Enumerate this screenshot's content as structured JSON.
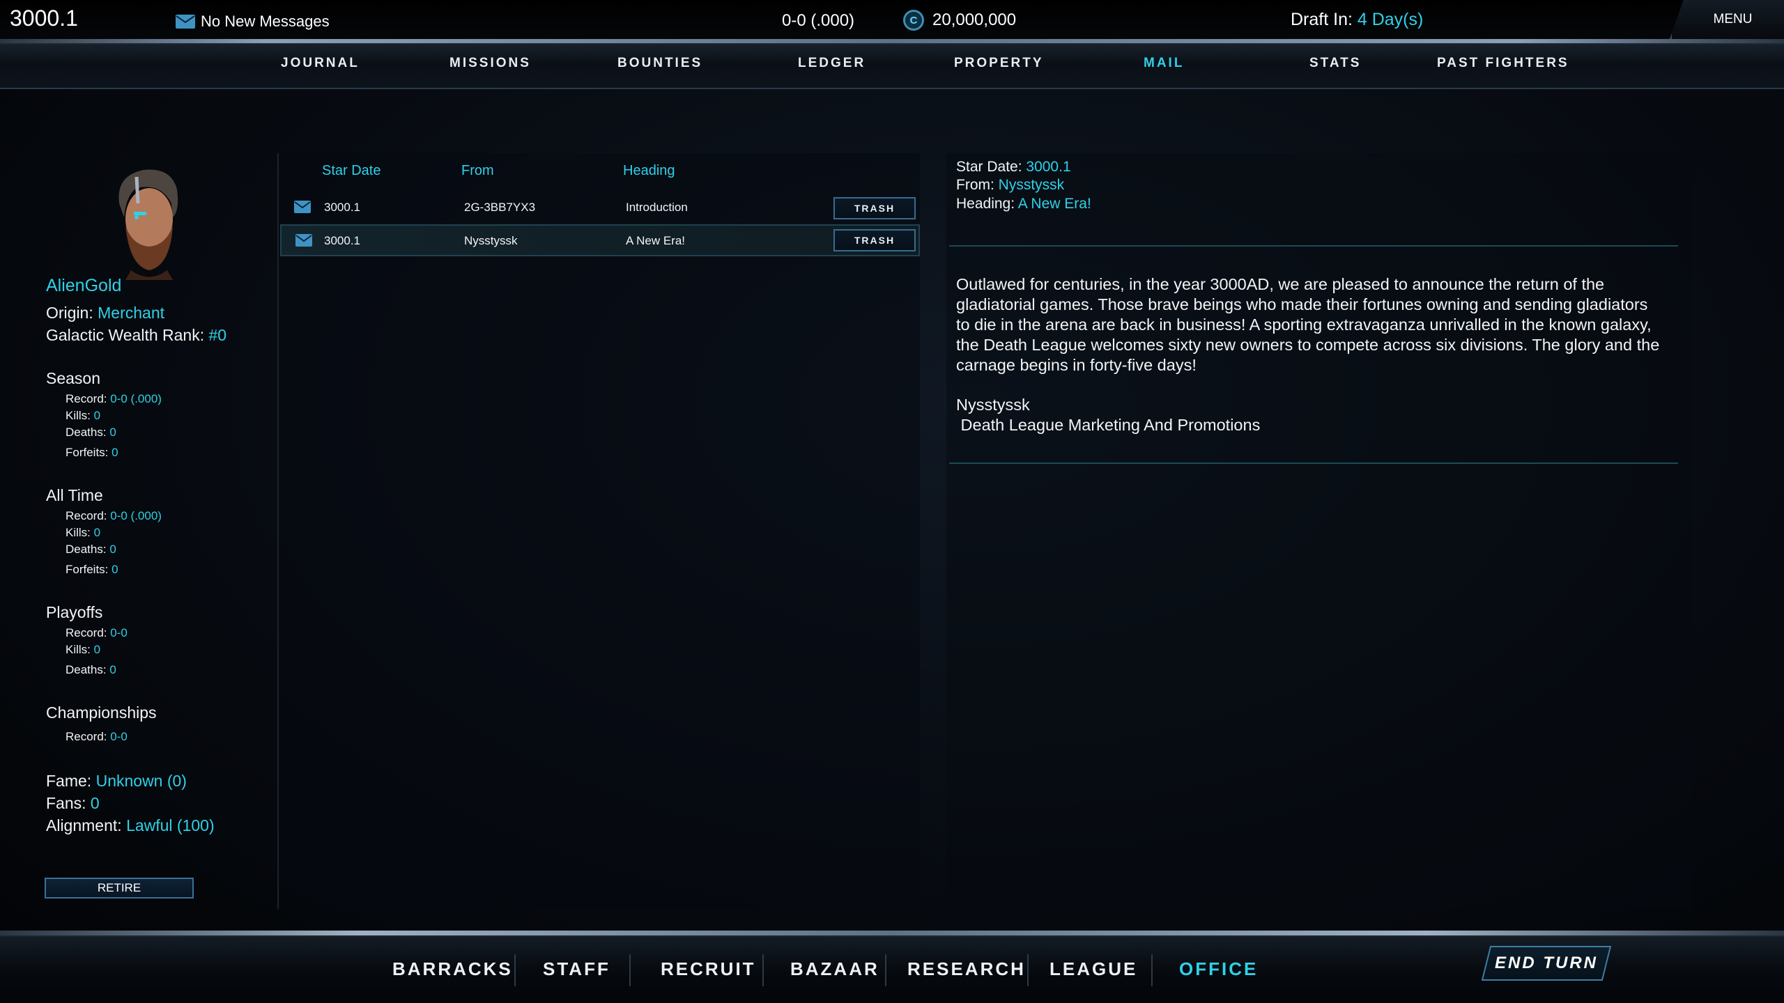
{
  "top": {
    "stardate": "3000.1",
    "messages": "No New Messages",
    "record": "0-0 (.000)",
    "credits": "20,000,000",
    "draft_label": "Draft In: ",
    "draft_value": "4 Day(s)",
    "menu": "MENU"
  },
  "nav": {
    "tabs": [
      "JOURNAL",
      "MISSIONS",
      "BOUNTIES",
      "LEDGER",
      "PROPERTY",
      "MAIL",
      "STATS",
      "PAST FIGHTERS"
    ],
    "active": "MAIL"
  },
  "profile": {
    "name": "AlienGold",
    "origin_label": "Origin: ",
    "origin_value": "Merchant",
    "rank_label": "Galactic Wealth Rank: ",
    "rank_value": "#0",
    "season": {
      "title": "Season",
      "record_label": "Record: ",
      "record_value": "0-0 (.000)",
      "kills_label": "Kills: ",
      "kills_value": "0",
      "deaths_label": "Deaths: ",
      "deaths_value": "0",
      "forfeits_label": "Forfeits: ",
      "forfeits_value": "0"
    },
    "all_time": {
      "title": "All Time",
      "record_label": "Record: ",
      "record_value": "0-0 (.000)",
      "kills_label": "Kills: ",
      "kills_value": "0",
      "deaths_label": "Deaths: ",
      "deaths_value": "0",
      "forfeits_label": "Forfeits: ",
      "forfeits_value": "0"
    },
    "playoffs": {
      "title": "Playoffs",
      "record_label": "Record: ",
      "record_value": "0-0",
      "kills_label": "Kills: ",
      "kills_value": "0",
      "deaths_label": "Deaths: ",
      "deaths_value": "0"
    },
    "championships": {
      "title": "Championships",
      "record_label": "Record: ",
      "record_value": "0-0"
    },
    "fame_label": "Fame: ",
    "fame_value": "Unknown (0)",
    "fans_label": "Fans: ",
    "fans_value": "0",
    "alignment_label": "Alignment: ",
    "alignment_value": "Lawful (100)",
    "retire": "RETIRE"
  },
  "mail": {
    "columns": {
      "stardate": "Star Date",
      "from": "From",
      "heading": "Heading"
    },
    "rows": [
      {
        "stardate": "3000.1",
        "from": "2G-3BB7YX3",
        "heading": "Introduction",
        "action": "TRASH",
        "selected": false
      },
      {
        "stardate": "3000.1",
        "from": "Nysstyssk",
        "heading": "A New Era!",
        "action": "TRASH",
        "selected": true
      }
    ]
  },
  "message": {
    "stardate_label": "Star Date: ",
    "stardate_value": "3000.1",
    "from_label": "From: ",
    "from_value": "Nysstyssk",
    "heading_label": "Heading: ",
    "heading_value": "A New Era!",
    "body": "Outlawed for centuries, in the year 3000AD, we are pleased to announce the return of the gladiatorial games. Those brave beings who made their fortunes owning and sending gladiators to die in the arena are back in business! A sporting extravaganza unrivalled in the known galaxy, the Death League welcomes sixty new owners to compete across six divisions. The glory and the carnage begins in forty-five days!",
    "signature_name": "Nysstyssk",
    "signature_title": " Death League Marketing And Promotions"
  },
  "bottom": {
    "tabs": [
      "BARRACKS",
      "STAFF",
      "RECRUIT",
      "BAZAAR",
      "RESEARCH",
      "LEAGUE",
      "OFFICE"
    ],
    "active": "OFFICE",
    "end_turn": "END TURN"
  },
  "colors": {
    "accent": "#2fd1e8",
    "text": "#f2f4f6",
    "panel_border": "#1d4a55"
  }
}
